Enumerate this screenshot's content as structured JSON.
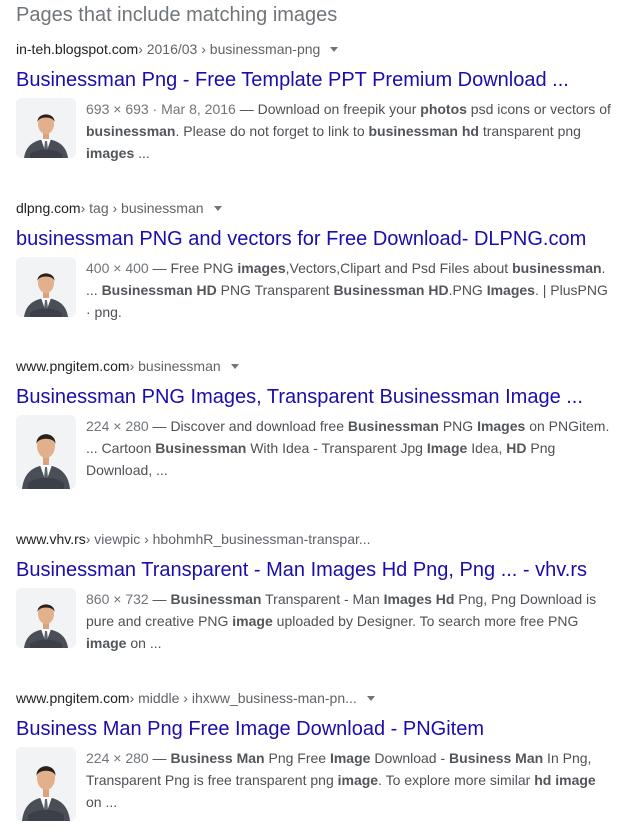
{
  "heading": "Pages that include matching images",
  "results": [
    {
      "domain": "in-teh.blogspot.com",
      "path": " › 2016/03 › businessman-png",
      "title": "Businessman Png - Free Template PPT Premium Download ...",
      "meta": "693 × 693 · Mar 8, 2016",
      "snippet": [
        {
          "t": " — Download on freepik your "
        },
        {
          "t": "photos",
          "b": true
        },
        {
          "t": " psd icons or vectors of "
        },
        {
          "t": "businessman",
          "b": true
        },
        {
          "t": ". Please do not forget to link to "
        },
        {
          "t": "businessman hd",
          "b": true
        },
        {
          "t": " transparent png "
        },
        {
          "t": "images",
          "b": true
        },
        {
          "t": " ..."
        }
      ]
    },
    {
      "domain": "dlpng.com",
      "path": " › tag › businessman",
      "title": "businessman PNG and vectors for Free Download- DLPNG.com",
      "meta": "400 × 400",
      "snippet": [
        {
          "t": " — Free PNG "
        },
        {
          "t": "images",
          "b": true
        },
        {
          "t": ",Vectors,Clipart and Psd Files about "
        },
        {
          "t": "businessman",
          "b": true
        },
        {
          "t": ". ... "
        },
        {
          "t": "Businessman HD",
          "b": true
        },
        {
          "t": " PNG Transparent "
        },
        {
          "t": "Businessman HD",
          "b": true
        },
        {
          "t": ".PNG "
        },
        {
          "t": "Images",
          "b": true
        },
        {
          "t": ". | PlusPNG · png."
        }
      ]
    },
    {
      "domain": "www.pngitem.com",
      "path": " › businessman",
      "title": "Businessman PNG Images, Transparent Businessman Image ...",
      "meta": "224 × 280",
      "snippet": [
        {
          "t": " — Discover and download free "
        },
        {
          "t": "Businessman",
          "b": true
        },
        {
          "t": " PNG "
        },
        {
          "t": "Images",
          "b": true
        },
        {
          "t": " on PNGitem. ... Cartoon "
        },
        {
          "t": "Businessman",
          "b": true
        },
        {
          "t": " With Idea - Transparent Jpg "
        },
        {
          "t": "Image",
          "b": true
        },
        {
          "t": " Idea, "
        },
        {
          "t": "HD",
          "b": true
        },
        {
          "t": " Png Download, ..."
        }
      ]
    },
    {
      "domain": "www.vhv.rs",
      "path": " › viewpic › hbohmhR_businessman-transpar...",
      "title": "Businessman Transparent - Man Images Hd Png, Png ... - vhv.rs",
      "meta": "860 × 732",
      "snippet": [
        {
          "t": " — "
        },
        {
          "t": "Businessman",
          "b": true
        },
        {
          "t": " Transparent - Man "
        },
        {
          "t": "Images Hd",
          "b": true
        },
        {
          "t": " Png, Png Download is pure and creative PNG "
        },
        {
          "t": "image",
          "b": true
        },
        {
          "t": " uploaded by Designer. To search more free PNG "
        },
        {
          "t": "image",
          "b": true
        },
        {
          "t": " on ..."
        }
      ]
    },
    {
      "domain": "www.pngitem.com",
      "path": " › middle › ihxww_business-man-pn...",
      "title": "Business Man Png Free Image Download - PNGitem",
      "meta": "224 × 280",
      "snippet": [
        {
          "t": " — "
        },
        {
          "t": "Business Man",
          "b": true
        },
        {
          "t": " Png Free "
        },
        {
          "t": "Image",
          "b": true
        },
        {
          "t": " Download - "
        },
        {
          "t": "Business Man",
          "b": true
        },
        {
          "t": " In Png, Transparent Png is free transparent png "
        },
        {
          "t": "image",
          "b": true
        },
        {
          "t": ". To explore more similar "
        },
        {
          "t": "hd image",
          "b": true
        },
        {
          "t": " on ..."
        }
      ]
    }
  ]
}
